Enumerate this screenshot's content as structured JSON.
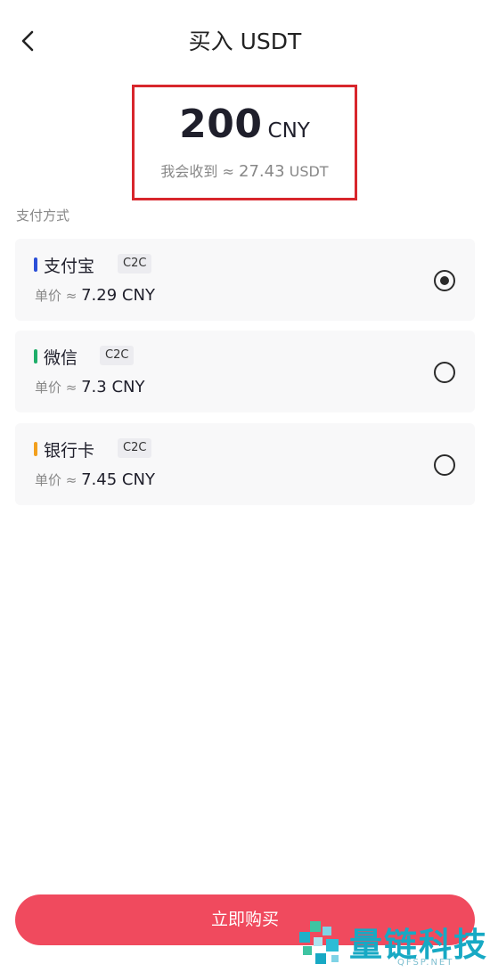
{
  "header": {
    "title": "买入 USDT",
    "back_icon": "chevron-left-icon"
  },
  "amount": {
    "value": "200",
    "currency": "CNY",
    "receive_label": "我会收到 ≈ ",
    "receive_value": "27.43",
    "receive_currency": " USDT"
  },
  "payment": {
    "section_label": "支付方式",
    "methods": [
      {
        "name": "支付宝",
        "tag": "C2C",
        "price_label": "单价 ≈ ",
        "price": "7.29 CNY",
        "color": "#2b4fd8",
        "selected": true
      },
      {
        "name": "微信",
        "tag": "C2C",
        "price_label": "单价 ≈ ",
        "price": "7.3 CNY",
        "color": "#1fae6a",
        "selected": false
      },
      {
        "name": "银行卡",
        "tag": "C2C",
        "price_label": "单价 ≈ ",
        "price": "7.45 CNY",
        "color": "#f2a01e",
        "selected": false
      }
    ]
  },
  "buy_button": {
    "label": "立即购买"
  },
  "watermark": {
    "text": "量链科技",
    "sub": "QFSP.NET"
  },
  "colors": {
    "accent": "#f04a5e",
    "highlight_border": "#d8262c"
  }
}
